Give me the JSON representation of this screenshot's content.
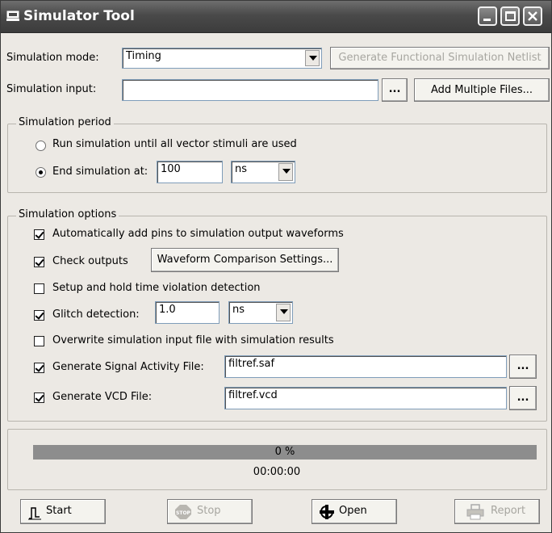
{
  "window": {
    "title": "Simulator Tool"
  },
  "simulation_mode": {
    "label": "Simulation mode:",
    "value": "Timing",
    "netlist_button": "Generate Functional Simulation Netlist"
  },
  "simulation_input": {
    "label": "Simulation input:",
    "value": "",
    "browse_label": "...",
    "add_multiple_label": "Add Multiple Files..."
  },
  "period": {
    "title": "Simulation period",
    "run_until_label": "Run simulation until all vector stimuli are used",
    "run_until_selected": false,
    "end_at_label": "End simulation at:",
    "end_at_selected": true,
    "end_value": "100",
    "end_unit": "ns"
  },
  "options": {
    "title": "Simulation options",
    "auto_add_pins": {
      "label": "Automatically add pins to simulation output waveforms",
      "checked": true
    },
    "check_outputs": {
      "label": "Check outputs",
      "checked": true,
      "settings_button": "Waveform Comparison Settings..."
    },
    "setup_hold": {
      "label": "Setup and hold time violation detection",
      "checked": false
    },
    "glitch": {
      "label": "Glitch detection:",
      "checked": true,
      "value": "1.0",
      "unit": "ns"
    },
    "overwrite": {
      "label": "Overwrite simulation input file with simulation results",
      "checked": false
    },
    "signal_activity": {
      "label": "Generate Signal Activity File:",
      "checked": true,
      "value": "filtref.saf",
      "browse_label": "..."
    },
    "vcd": {
      "label": "Generate VCD File:",
      "checked": true,
      "value": "filtref.vcd",
      "browse_label": "..."
    }
  },
  "progress": {
    "percent_text": "0 %",
    "fraction": 0,
    "elapsed": "00:00:00"
  },
  "actions": {
    "start": "Start",
    "stop": "Stop",
    "open": "Open",
    "report": "Report"
  }
}
